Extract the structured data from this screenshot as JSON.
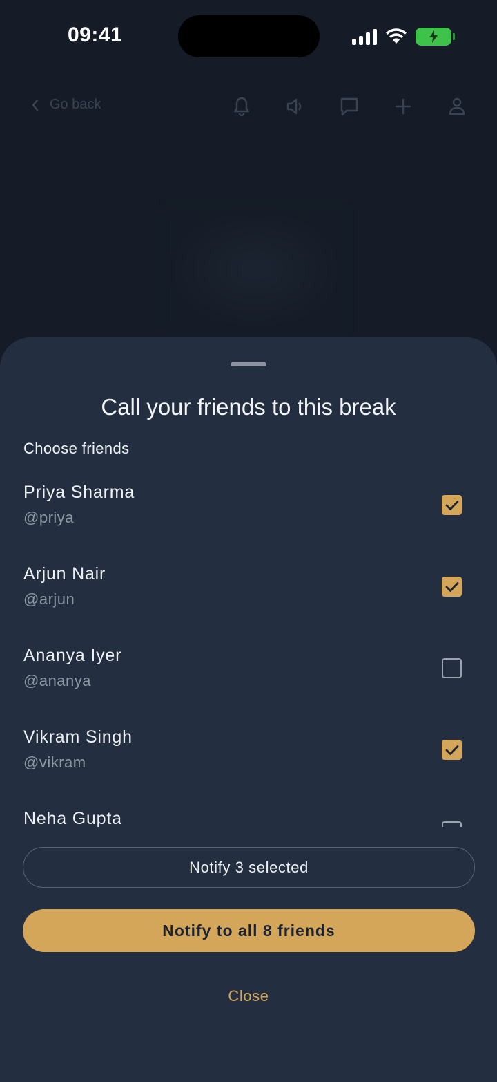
{
  "status_bar": {
    "time": "09:41"
  },
  "top_nav": {
    "back_label": "Go back"
  },
  "sheet": {
    "title": "Call your friends to this break",
    "section_label": "Choose friends",
    "friends": [
      {
        "name": "Priya Sharma",
        "handle": "@priya",
        "checked": true
      },
      {
        "name": "Arjun Nair",
        "handle": "@arjun",
        "checked": true
      },
      {
        "name": "Ananya Iyer",
        "handle": "@ananya",
        "checked": false
      },
      {
        "name": "Vikram Singh",
        "handle": "@vikram",
        "checked": true
      },
      {
        "name": "Neha Gupta",
        "handle": "",
        "checked": false
      }
    ],
    "notify_selected_label": "Notify 3 selected",
    "notify_all_label": "Notify to all 8 friends",
    "close_label": "Close"
  },
  "colors": {
    "accent": "#d4a65a",
    "sheet_bg": "#232f40",
    "page_bg": "#151c27",
    "battery": "#3ec24a"
  },
  "icons": [
    "chevron-left-icon",
    "bell-icon",
    "speaker-icon",
    "chat-icon",
    "plus-icon",
    "person-icon",
    "check-icon"
  ]
}
